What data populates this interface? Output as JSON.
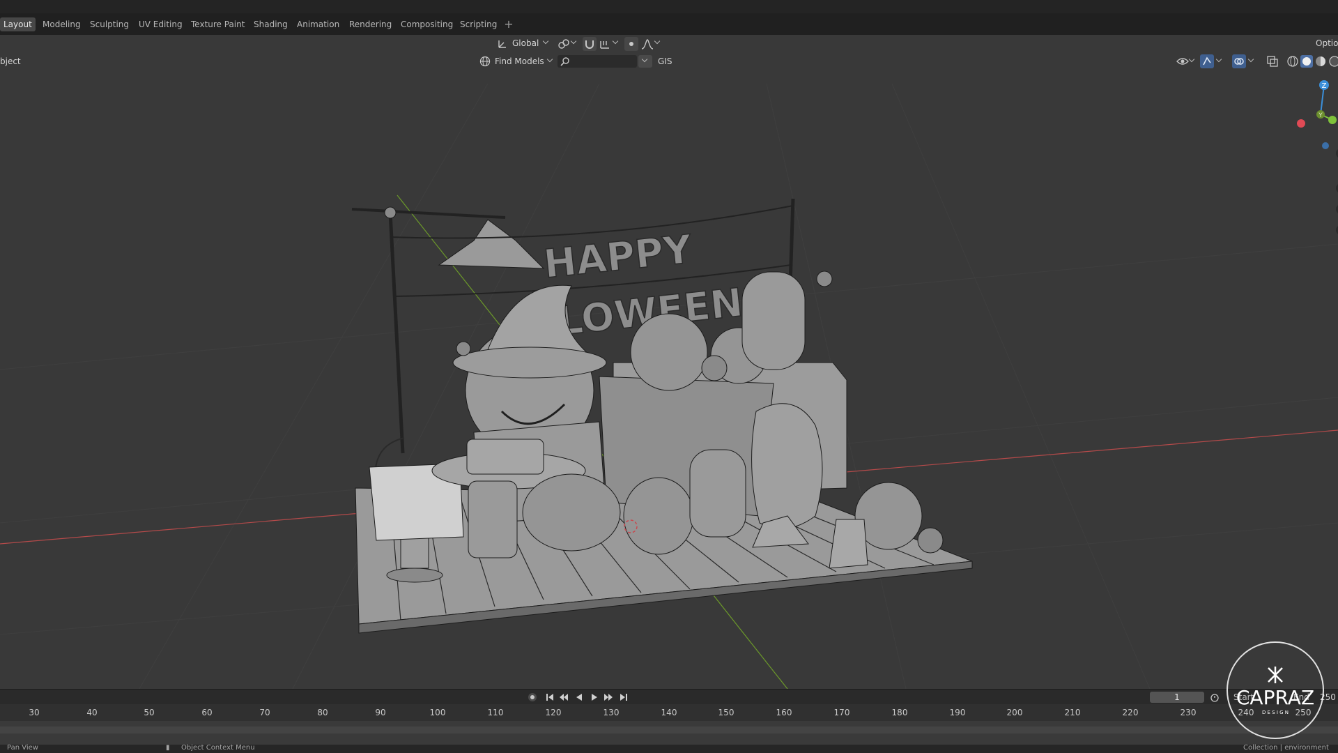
{
  "workspace_tabs": [
    {
      "label": "Layout",
      "active": true
    },
    {
      "label": "Modeling"
    },
    {
      "label": "Sculpting"
    },
    {
      "label": "UV Editing"
    },
    {
      "label": "Texture Paint"
    },
    {
      "label": "Shading"
    },
    {
      "label": "Animation"
    },
    {
      "label": "Rendering"
    },
    {
      "label": "Compositing"
    },
    {
      "label": "Scripting"
    }
  ],
  "add_workspace": "+",
  "viewport_header": {
    "mode_label": "bject",
    "transform_orientation": "Global",
    "find_models": "Find Models",
    "gis": "GIS",
    "options": "Optior"
  },
  "scene_text": {
    "banner_top": "HAPPY",
    "banner_bottom": "LOWEEN"
  },
  "timeline": {
    "current_frame": "1",
    "start_label": "Start",
    "end_label": "End",
    "end_value": "250",
    "ticks": [
      "30",
      "40",
      "50",
      "60",
      "70",
      "80",
      "90",
      "100",
      "110",
      "120",
      "130",
      "140",
      "150",
      "160",
      "170",
      "180",
      "190",
      "200",
      "210",
      "220",
      "230",
      "240",
      "250"
    ]
  },
  "status": {
    "left": "Pan View",
    "middle": "Object Context Menu",
    "right": "Collection | environment"
  },
  "watermark": {
    "text": "CAPRAZ",
    "sub": "D E S I G N"
  },
  "colors": {
    "x_axis": "#b54a4a",
    "y_axis": "#6c9a2a",
    "gizmo_z": "#3b8fd9",
    "gizmo_y": "#7fc23a",
    "gizmo_x": "#e04a55"
  }
}
